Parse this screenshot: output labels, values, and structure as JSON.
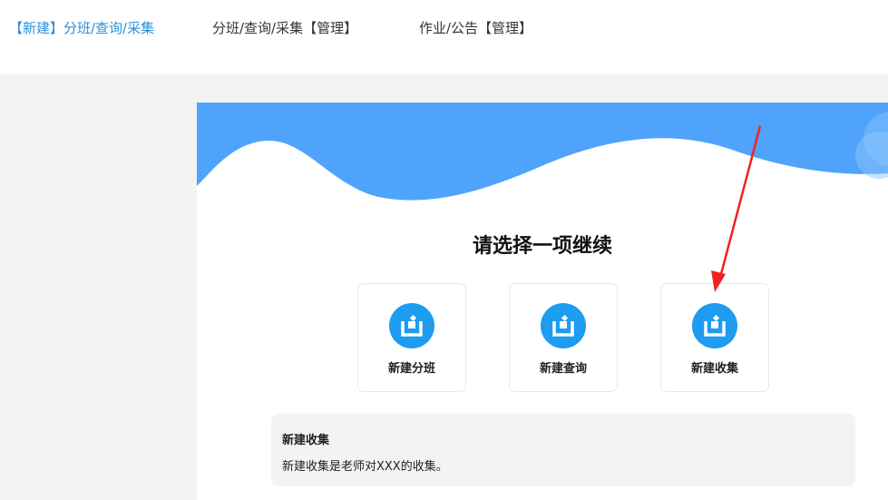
{
  "nav": {
    "tabs": [
      {
        "label": "【新建】分班/查询/采集",
        "active": true
      },
      {
        "label": "分班/查询/采集【管理】",
        "active": false
      },
      {
        "label": "作业/公告【管理】",
        "active": false
      }
    ]
  },
  "main": {
    "heading": "请选择一项继续",
    "options": [
      {
        "label": "新建分班",
        "icon": "upload-tray-icon"
      },
      {
        "label": "新建查询",
        "icon": "upload-tray-icon"
      },
      {
        "label": "新建收集",
        "icon": "upload-tray-icon"
      }
    ],
    "description": {
      "title": "新建收集",
      "text": "新建收集是老师对XXX的收集。"
    }
  },
  "colors": {
    "accent": "#2b8fd6",
    "wave": "#4fa3fb",
    "icon_bg": "#1d9cf0",
    "annotation_arrow": "#f02222"
  }
}
